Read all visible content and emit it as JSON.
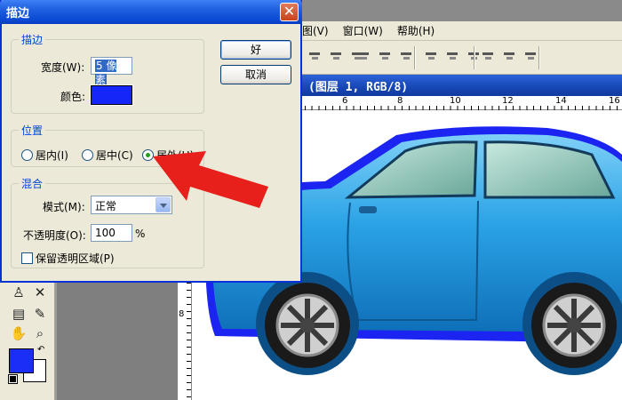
{
  "menubar": {
    "items": [
      "图(V)",
      "窗口(W)",
      "帮助(H)"
    ]
  },
  "document": {
    "title": "(图层 1, RGB/8)"
  },
  "ruler": {
    "h_ticks": [
      "6",
      "8",
      "10",
      "12",
      "14",
      "16"
    ],
    "v_ticks": [
      "8"
    ]
  },
  "dialog": {
    "title": "描边",
    "close_icon": "close-icon",
    "stroke_group": {
      "legend": "描边",
      "width_label": "宽度(W):",
      "width_value": "5 像素",
      "color_label": "颜色:",
      "color_value": "#1426f8"
    },
    "position_group": {
      "legend": "位置",
      "options": [
        {
          "label": "居内(I)",
          "selected": false
        },
        {
          "label": "居中(C)",
          "selected": false
        },
        {
          "label": "居外(U)",
          "selected": true
        }
      ]
    },
    "blend_group": {
      "legend": "混合",
      "mode_label": "模式(M):",
      "mode_value": "正常",
      "opacity_label": "不透明度(O):",
      "opacity_value": "100",
      "opacity_unit": "%",
      "preserve_label": "保留透明区域(P)",
      "preserve_checked": false
    },
    "ok_label": "好",
    "cancel_label": "取消"
  },
  "colors": {
    "foreground": "#1a2ef5",
    "background": "#ffffff",
    "accent": "#0046d5",
    "annotation_arrow": "#e8201c"
  }
}
